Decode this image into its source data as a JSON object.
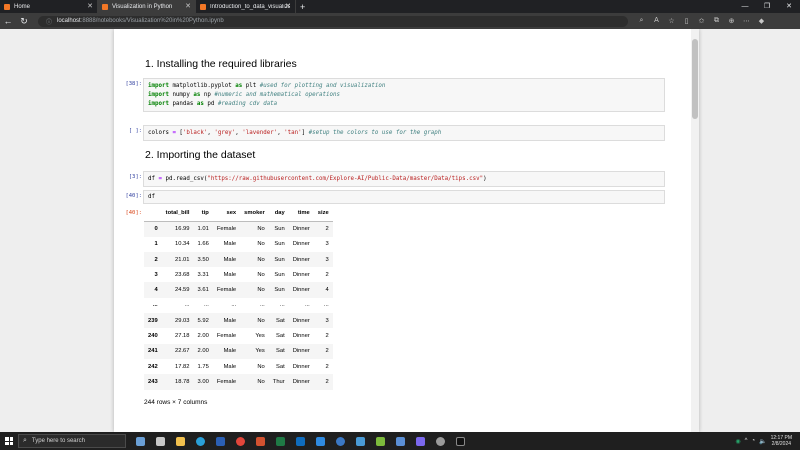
{
  "browser": {
    "tabs": [
      {
        "title": "Home",
        "active": false
      },
      {
        "title": "Visualization in Python",
        "active": true
      },
      {
        "title": "Introduction_to_data_visualizati...",
        "active": false
      }
    ],
    "url_host": "localhost",
    "url_rest": ":8888/notebooks/Visualization%20in%20Python.ipynb"
  },
  "notebook": {
    "heading1": "1. Installing the required libraries",
    "heading2": "2. Importing the dataset",
    "prompt_libs": "[38]:",
    "prompt_colors": "[ ]:",
    "prompt_read": "[3]:",
    "prompt_df": "[40]:",
    "prompt_out": "[40]:",
    "code_df": "df",
    "shape": "244 rows × 7 columns"
  },
  "table": {
    "columns": [
      "total_bill",
      "tip",
      "sex",
      "smoker",
      "day",
      "time",
      "size"
    ],
    "rows": [
      {
        "idx": "0",
        "cells": [
          "16.99",
          "1.01",
          "Female",
          "No",
          "Sun",
          "Dinner",
          "2"
        ]
      },
      {
        "idx": "1",
        "cells": [
          "10.34",
          "1.66",
          "Male",
          "No",
          "Sun",
          "Dinner",
          "3"
        ]
      },
      {
        "idx": "2",
        "cells": [
          "21.01",
          "3.50",
          "Male",
          "No",
          "Sun",
          "Dinner",
          "3"
        ]
      },
      {
        "idx": "3",
        "cells": [
          "23.68",
          "3.31",
          "Male",
          "No",
          "Sun",
          "Dinner",
          "2"
        ]
      },
      {
        "idx": "4",
        "cells": [
          "24.59",
          "3.61",
          "Female",
          "No",
          "Sun",
          "Dinner",
          "4"
        ]
      },
      {
        "idx": "...",
        "cells": [
          "...",
          "...",
          "...",
          "...",
          "...",
          "...",
          "..."
        ]
      },
      {
        "idx": "239",
        "cells": [
          "29.03",
          "5.92",
          "Male",
          "No",
          "Sat",
          "Dinner",
          "3"
        ]
      },
      {
        "idx": "240",
        "cells": [
          "27.18",
          "2.00",
          "Female",
          "Yes",
          "Sat",
          "Dinner",
          "2"
        ]
      },
      {
        "idx": "241",
        "cells": [
          "22.67",
          "2.00",
          "Male",
          "Yes",
          "Sat",
          "Dinner",
          "2"
        ]
      },
      {
        "idx": "242",
        "cells": [
          "17.82",
          "1.75",
          "Male",
          "No",
          "Sat",
          "Dinner",
          "2"
        ]
      },
      {
        "idx": "243",
        "cells": [
          "18.78",
          "3.00",
          "Female",
          "No",
          "Thur",
          "Dinner",
          "2"
        ]
      }
    ]
  },
  "taskbar": {
    "search_placeholder": "Type here to search",
    "time": "12:17 PM",
    "date": "2/8/2024"
  },
  "colors": {
    "code_bg": "#f7f7f7",
    "prompt_in": "#303f9f",
    "prompt_out": "#d84315",
    "keyword": "#008000",
    "comment": "#408080",
    "string": "#ba2121"
  }
}
